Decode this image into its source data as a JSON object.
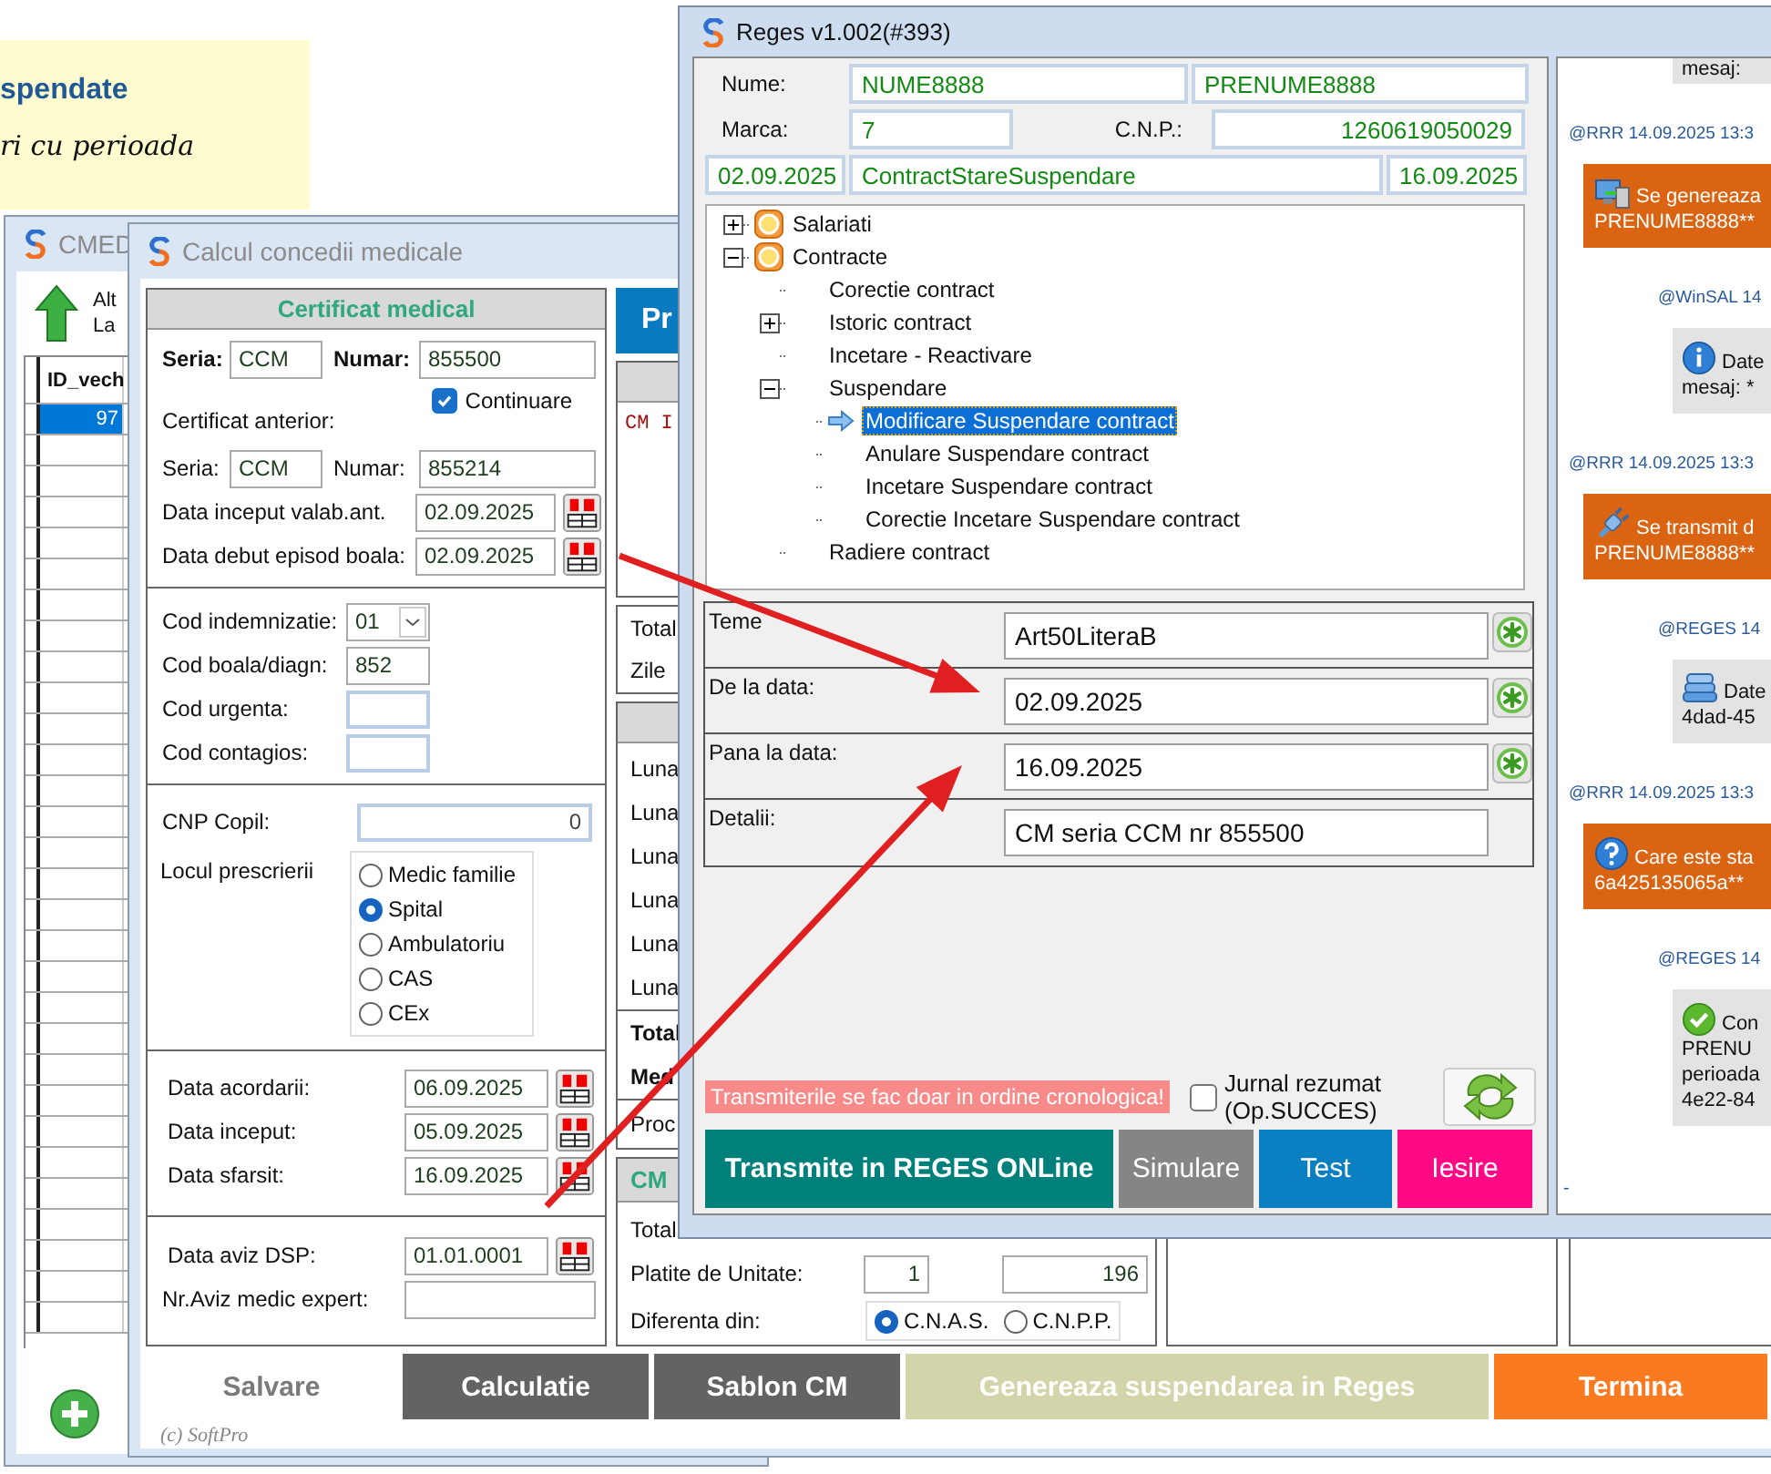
{
  "sticky_note": {
    "heading": "spendate",
    "line": "ri cu perioada"
  },
  "cmed_window": {
    "title": "CMED",
    "toolbar_text": [
      "Alt",
      "La"
    ],
    "table": {
      "columns": [
        "ID_vech"
      ],
      "rows": [
        {
          "id": "97",
          "selected": true
        }
      ]
    }
  },
  "calcul_window": {
    "title": "Calcul concedii medicale",
    "certificate": {
      "title": "Certificat medical",
      "current": [
        {
          "label": "Seria:",
          "value": "CCM"
        },
        {
          "label": "Numar:",
          "value": "855500"
        }
      ],
      "continuation": {
        "label": "Continuare",
        "checked": true
      },
      "previous_title": "Certificat anterior:",
      "previous": [
        {
          "label": "Seria:",
          "value": "CCM"
        },
        {
          "label": "Numar:",
          "value": "855214"
        }
      ],
      "dates": [
        {
          "label": "Data inceput valab.ant.",
          "value": "02.09.2025"
        },
        {
          "label": "Data debut episod boala:",
          "value": "02.09.2025"
        }
      ]
    },
    "codes": [
      {
        "label": "Cod indemnizatie:",
        "value": "01",
        "kind": "dropdown"
      },
      {
        "label": "Cod boala/diagn:",
        "value": "852",
        "kind": "text"
      },
      {
        "label": "Cod urgenta:",
        "kind": "text"
      },
      {
        "label": "Cod contagios:",
        "kind": "text"
      }
    ],
    "cnp_copil": {
      "label": "CNP Copil:",
      "value": "0"
    },
    "prescription": {
      "label": "Locul prescrierii",
      "options": [
        {
          "label": "Medic familie",
          "selected": false
        },
        {
          "label": "Spital",
          "selected": true
        },
        {
          "label": "Ambulatoriu",
          "selected": false
        },
        {
          "label": "CAS",
          "selected": false
        },
        {
          "label": "CEx",
          "selected": false
        }
      ]
    },
    "period": [
      {
        "label": "Data acordarii:",
        "value": "06.09.2025"
      },
      {
        "label": "Data inceput:",
        "value": "05.09.2025"
      },
      {
        "label": "Data sfarsit:",
        "value": "16.09.2025"
      }
    ],
    "aviz": [
      {
        "label": "Data aviz DSP:",
        "value": "01.01.0001",
        "kind": "date"
      },
      {
        "label": "Nr.Aviz medic expert:",
        "kind": "text"
      }
    ],
    "summary": {
      "action_button": "Pr",
      "code_text": "CM I",
      "day_rows": [
        "Total",
        "Zile"
      ],
      "month_rows": [
        "Luna",
        "Luna",
        "Luna",
        "Luna",
        "Luna",
        "Luna"
      ],
      "average_rows": [
        "Total",
        "Med"
      ],
      "percent_row": "Proc",
      "cm_header": "CM",
      "cm_total": "Total",
      "paid": {
        "label": "Platite de Unitate:",
        "values": [
          "1",
          "196"
        ]
      },
      "difference": {
        "label": "Diferenta din:",
        "options": [
          {
            "label": "C.N.A.S.",
            "selected": true
          },
          {
            "label": "C.N.P.P.",
            "selected": false
          }
        ]
      }
    },
    "buttons": [
      {
        "label": "Salvare",
        "kind": "plain"
      },
      {
        "label": "Calculatie",
        "kind": "dark"
      },
      {
        "label": "Sablon CM",
        "kind": "dark"
      },
      {
        "label": "Genereaza suspendarea in Reges",
        "kind": "disabled"
      },
      {
        "label": "Termina",
        "kind": "accent"
      }
    ],
    "copyright": "(c) SoftPro"
  },
  "reges_window": {
    "title": "Reges v1.002(#393)",
    "employee": {
      "name_label": "Nume:",
      "last_name": "NUME8888",
      "first_name": "PRENUME8888",
      "marca_label": "Marca:",
      "marca": "7",
      "cnp_label": "C.N.P.:",
      "cnp": "1260619050029",
      "start_date": "02.09.2025",
      "status": "ContractStareSuspendare",
      "end_date": "16.09.2025"
    },
    "tree": [
      {
        "label": "Salariati",
        "expanded": false,
        "selected": false
      },
      {
        "label": "Contracte",
        "expanded": true,
        "selected": false,
        "children": [
          {
            "label": "Corectie contract",
            "selected": false
          },
          {
            "label": "Istoric contract",
            "expanded": false,
            "selected": false
          },
          {
            "label": "Incetare - Reactivare",
            "selected": false
          },
          {
            "label": "Suspendare",
            "expanded": true,
            "selected": false,
            "children": [
              {
                "label": "Modificare Suspendare contract",
                "selected": true
              },
              {
                "label": "Anulare Suspendare contract",
                "selected": false
              },
              {
                "label": "Incetare Suspendare contract",
                "selected": false
              },
              {
                "label": "Corectie Incetare Suspendare contract",
                "selected": false
              }
            ]
          },
          {
            "label": "Radiere contract",
            "selected": false
          }
        ]
      }
    ],
    "form": [
      {
        "label": "Teme",
        "value": "Art50LiteraB",
        "kind": "pick"
      },
      {
        "label": "De la data:",
        "value": "02.09.2025",
        "kind": "pick"
      },
      {
        "label": "Pana la data:",
        "value": "16.09.2025",
        "kind": "pick"
      },
      {
        "label": "Detalii:",
        "value": "CM seria CCM nr 855500",
        "kind": "text"
      }
    ],
    "warning": "Transmiterile se fac doar in ordine cronologica!",
    "journal": {
      "label": "Jurnal rezumat (Op.SUCCES)",
      "checked": false
    },
    "buttons": [
      {
        "label": "Transmite in REGES ONLine",
        "kind": "primary"
      },
      {
        "label": "Simulare",
        "kind": "secondary"
      },
      {
        "label": "Test",
        "kind": "info"
      },
      {
        "label": "Iesire",
        "kind": "danger"
      }
    ],
    "chat": {
      "messages": [
        {
          "kind": "note",
          "lines": [
            "mesaj:"
          ]
        },
        {
          "header": "@RRR 14.09.2025 13:3",
          "kind": "generate",
          "lines": [
            "Se genereaza",
            "PRENUME8888**"
          ]
        },
        {
          "header": "@WinSAL 14",
          "kind": "info",
          "lines": [
            "Date",
            "mesaj: *"
          ]
        },
        {
          "header": "@RRR 14.09.2025 13:3",
          "kind": "transmit",
          "lines": [
            "Se transmit d",
            "PRENUME8888**"
          ]
        },
        {
          "header": "@REGES 14",
          "kind": "data",
          "lines": [
            "Date",
            "4dad-45"
          ]
        },
        {
          "header": "@RRR 14.09.2025 13:3",
          "kind": "question",
          "lines": [
            "Care este sta",
            "6a425135065a**"
          ]
        },
        {
          "header": "@REGES 14",
          "kind": "success",
          "lines": [
            "Con",
            "PRENU",
            "perioada",
            "4e22-84"
          ]
        }
      ],
      "footer": "-"
    }
  }
}
